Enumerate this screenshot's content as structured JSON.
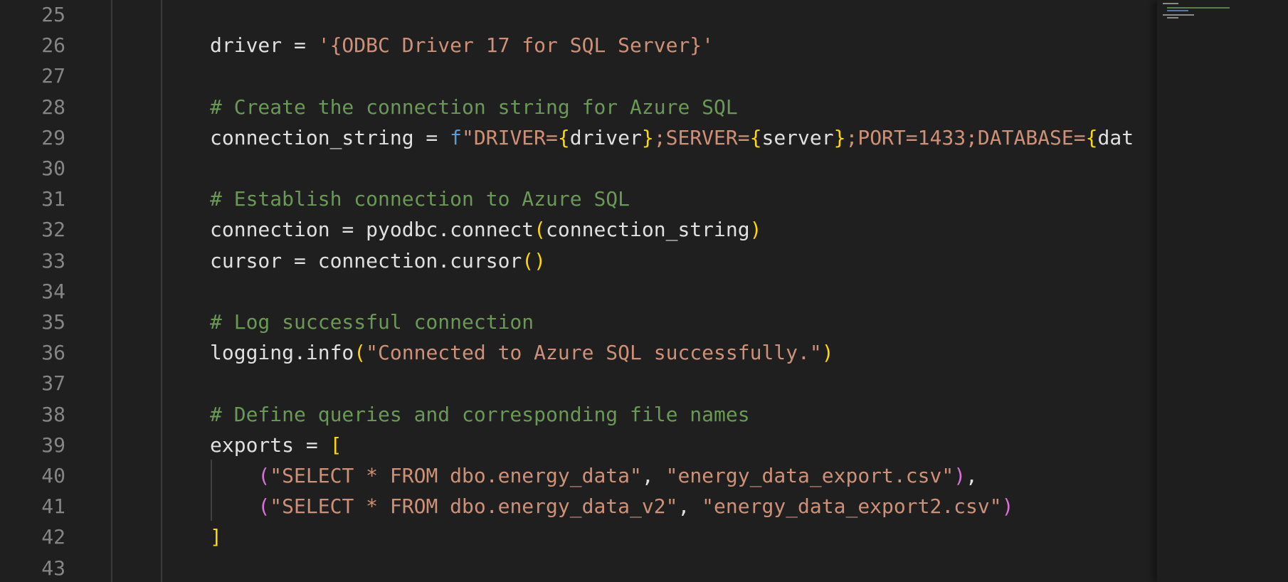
{
  "editor": {
    "lines": [
      {
        "num": "25",
        "tokens": []
      },
      {
        "num": "26",
        "tokens": [
          {
            "t": "driver = ",
            "c": "var"
          },
          {
            "t": "'{ODBC Driver 17 for SQL Server}'",
            "c": "str"
          }
        ]
      },
      {
        "num": "27",
        "tokens": []
      },
      {
        "num": "28",
        "tokens": [
          {
            "t": "# Create the connection string for Azure SQL",
            "c": "cmt"
          }
        ]
      },
      {
        "num": "29",
        "tokens": [
          {
            "t": "connection_string = ",
            "c": "var"
          },
          {
            "t": "f",
            "c": "fpre"
          },
          {
            "t": "\"DRIVER=",
            "c": "str"
          },
          {
            "t": "{",
            "c": "brace"
          },
          {
            "t": "driver",
            "c": "var"
          },
          {
            "t": "}",
            "c": "brace"
          },
          {
            "t": ";SERVER=",
            "c": "str"
          },
          {
            "t": "{",
            "c": "brace"
          },
          {
            "t": "server",
            "c": "var"
          },
          {
            "t": "}",
            "c": "brace"
          },
          {
            "t": ";PORT=1433;DATABASE=",
            "c": "str"
          },
          {
            "t": "{",
            "c": "brace"
          },
          {
            "t": "dat",
            "c": "var"
          }
        ]
      },
      {
        "num": "30",
        "tokens": []
      },
      {
        "num": "31",
        "tokens": [
          {
            "t": "# Establish connection to Azure SQL",
            "c": "cmt"
          }
        ]
      },
      {
        "num": "32",
        "tokens": [
          {
            "t": "connection = pyodbc.connect",
            "c": "var"
          },
          {
            "t": "(",
            "c": "brace"
          },
          {
            "t": "connection_string",
            "c": "var"
          },
          {
            "t": ")",
            "c": "brace"
          }
        ]
      },
      {
        "num": "33",
        "tokens": [
          {
            "t": "cursor = connection.cursor",
            "c": "var"
          },
          {
            "t": "()",
            "c": "brace"
          }
        ]
      },
      {
        "num": "34",
        "tokens": []
      },
      {
        "num": "35",
        "tokens": [
          {
            "t": "# Log successful connection",
            "c": "cmt"
          }
        ]
      },
      {
        "num": "36",
        "tokens": [
          {
            "t": "logging.info",
            "c": "var"
          },
          {
            "t": "(",
            "c": "brace"
          },
          {
            "t": "\"Connected to Azure SQL successfully.\"",
            "c": "str"
          },
          {
            "t": ")",
            "c": "brace"
          }
        ]
      },
      {
        "num": "37",
        "tokens": []
      },
      {
        "num": "38",
        "tokens": [
          {
            "t": "# Define queries and corresponding file names",
            "c": "cmt"
          }
        ]
      },
      {
        "num": "39",
        "tokens": [
          {
            "t": "exports = ",
            "c": "var"
          },
          {
            "t": "[",
            "c": "brace"
          }
        ]
      },
      {
        "num": "40",
        "tokens": [
          {
            "t": "    ",
            "c": "var"
          },
          {
            "t": "(",
            "c": "paren2"
          },
          {
            "t": "\"SELECT * FROM dbo.energy_data\"",
            "c": "str"
          },
          {
            "t": ", ",
            "c": "var"
          },
          {
            "t": "\"energy_data_export.csv\"",
            "c": "str"
          },
          {
            "t": ")",
            "c": "paren2"
          },
          {
            "t": ",",
            "c": "var"
          }
        ]
      },
      {
        "num": "41",
        "tokens": [
          {
            "t": "    ",
            "c": "var"
          },
          {
            "t": "(",
            "c": "paren2"
          },
          {
            "t": "\"SELECT * FROM dbo.energy_data_v2\"",
            "c": "str"
          },
          {
            "t": ", ",
            "c": "var"
          },
          {
            "t": "\"energy_data_export2.csv\"",
            "c": "str"
          },
          {
            "t": ")",
            "c": "paren2"
          }
        ]
      },
      {
        "num": "42",
        "tokens": [
          {
            "t": "]",
            "c": "brace"
          }
        ]
      },
      {
        "num": "43",
        "tokens": []
      }
    ]
  },
  "colors": {
    "background": "#1f1f1f",
    "line_number": "#858585",
    "string": "#ce9178",
    "comment": "#6a9955",
    "keyword_prefix": "#569cd6",
    "bracket_gold": "#ffd700",
    "bracket_purple": "#da70d6"
  }
}
